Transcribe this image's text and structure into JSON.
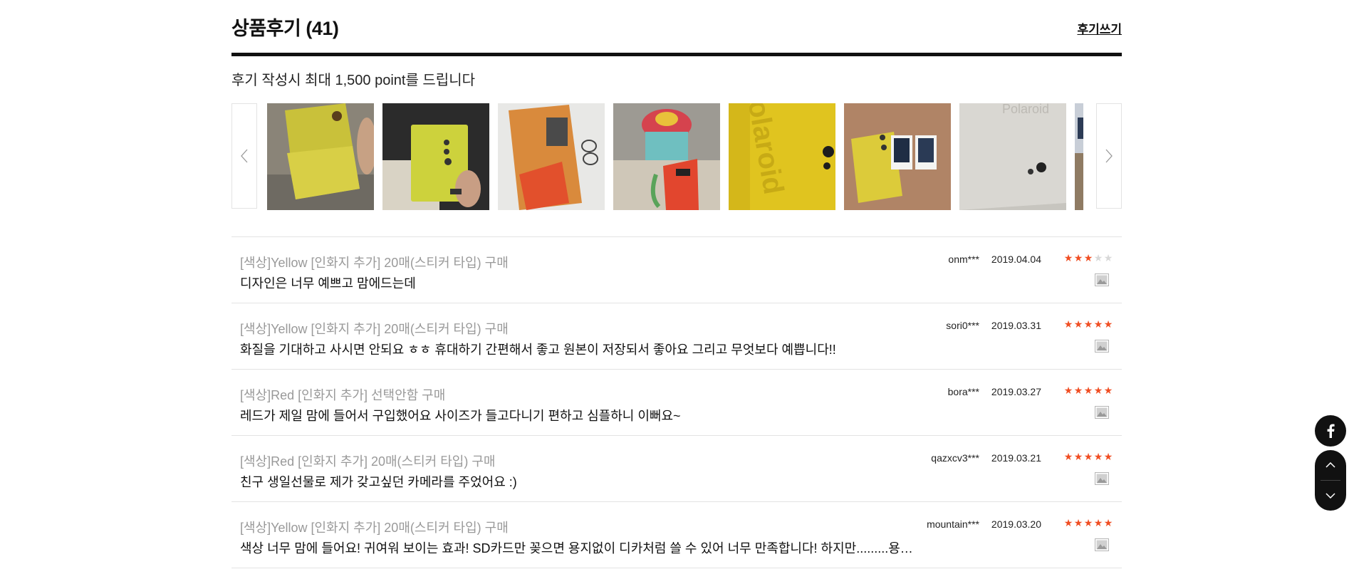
{
  "header": {
    "title": "상품후기 (41)",
    "write_link": "후기쓰기"
  },
  "notice": "후기 작성시 최대 1,500 point를 드립니다",
  "gallery": {
    "prev_icon": "chevron-left-icon",
    "next_icon": "chevron-right-icon"
  },
  "colors": {
    "star_on": "#f04e23",
    "star_off": "#d8d8d8",
    "divider": "#111111"
  },
  "reviews": [
    {
      "option": "[색상]Yellow [인화지 추가] 20매(스티커 타입) 구매",
      "text": "디자인은 너무 예쁘고 맘에드는데",
      "user": "onm***",
      "date": "2019.04.04",
      "rating": 3
    },
    {
      "option": "[색상]Yellow [인화지 추가] 20매(스티커 타입) 구매",
      "text": "화질을 기대하고 사시면 안되요 ㅎㅎ 휴대하기 간편해서 좋고 원본이 저장되서 좋아요 그리고 무엇보다 예쁩니다!!",
      "user": "sori0***",
      "date": "2019.03.31",
      "rating": 5
    },
    {
      "option": "[색상]Red [인화지 추가] 선택안함 구매",
      "text": "레드가 제일 맘에 들어서 구입했어요 사이즈가 들고다니기 편하고 심플하니 이뻐요~",
      "user": "bora***",
      "date": "2019.03.27",
      "rating": 5
    },
    {
      "option": "[색상]Red [인화지 추가] 20매(스티커 타입) 구매",
      "text": "친구 생일선물로 제가 갖고싶던 카메라를 주었어요 :)",
      "user": "qazxcv3***",
      "date": "2019.03.21",
      "rating": 5
    },
    {
      "option": "[색상]Yellow [인화지 추가] 20매(스티커 타입) 구매",
      "text": "색상 너무 맘에 들어요! 귀여워 보이는 효과! SD카드만 꽂으면 용지없이 디카처럼 쓸 수 있어 너무 만족합니다! 하지만.........용지로 인화...",
      "user": "mountain***",
      "date": "2019.03.20",
      "rating": 5
    }
  ],
  "floating": {
    "facebook_icon": "facebook-icon",
    "up_icon": "chevron-up-icon",
    "down_icon": "chevron-down-icon"
  }
}
